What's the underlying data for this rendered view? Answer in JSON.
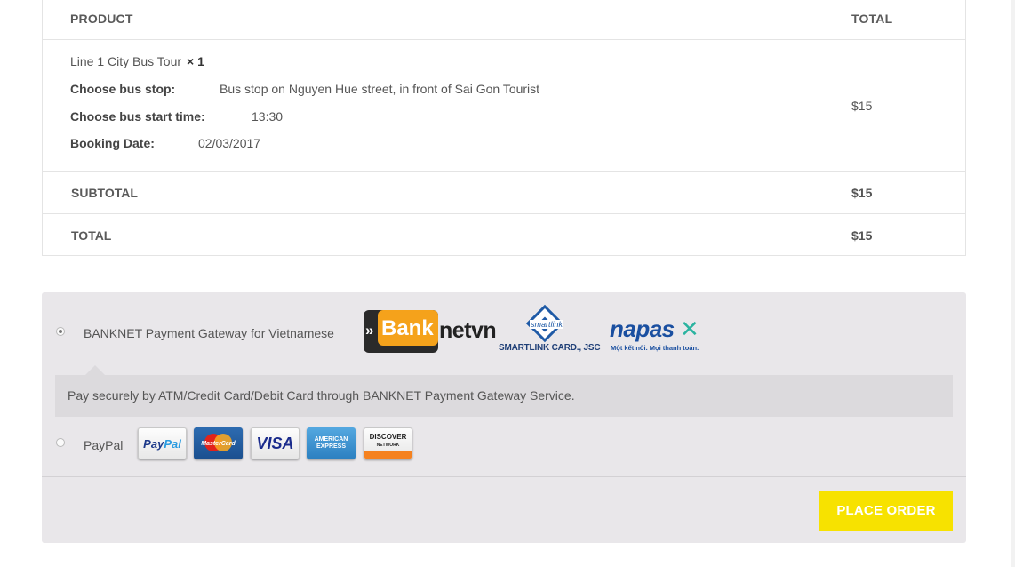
{
  "order": {
    "header": {
      "product": "PRODUCT",
      "total": "TOTAL"
    },
    "item": {
      "name": "Line 1 City Bus Tour",
      "qty": "× 1",
      "meta": [
        {
          "key": "Choose bus stop:",
          "value": "Bus stop on Nguyen Hue street, in front of Sai Gon Tourist"
        },
        {
          "key": "Choose bus start time:",
          "value": "13:30"
        },
        {
          "key": "Booking Date:",
          "value": "02/03/2017"
        }
      ],
      "price": "$15"
    },
    "subtotal": {
      "label": "SUBTOTAL",
      "value": "$15"
    },
    "total": {
      "label": "TOTAL",
      "value": "$15"
    }
  },
  "payment": {
    "methods": [
      {
        "label": "BANKNET Payment Gateway for Vietnamese",
        "selected": true,
        "description": "Pay securely by ATM/Credit Card/Debit Card through BANKNET Payment Gateway Service."
      },
      {
        "label": "PayPal",
        "selected": false
      }
    ],
    "logos": {
      "banknet_mark": "Bank",
      "banknet_tail": "netvn",
      "smartlink_word": "smartlink",
      "smartlink_text": "SMARTLINK CARD., JSC",
      "napas_word": "napas",
      "napas_tag": "Một kết nối. Mọi thanh toán."
    },
    "cards": {
      "paypal_a": "Pay",
      "paypal_b": "Pal",
      "mastercard": "MasterCard",
      "visa": "VISA",
      "amex": "AMERICAN EXPRESS",
      "discover": "DISCOVER",
      "discover_sub": "NETWORK"
    },
    "place_order": "PLACE ORDER"
  },
  "colors": {
    "button": "#f7e200",
    "panel": "#e9e7ea",
    "description_box": "#dcdadd"
  }
}
